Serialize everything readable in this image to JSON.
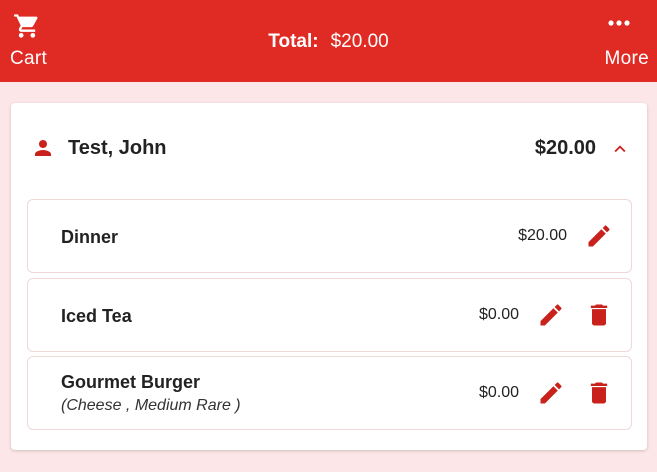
{
  "topbar": {
    "cart_label": "Cart",
    "total_label": "Total:",
    "total_value": "$20.00",
    "more_label": "More",
    "color": "#e02b25"
  },
  "order": {
    "customer_name": "Test, John",
    "customer_total": "$20.00",
    "expanded": true,
    "items": [
      {
        "name": "Dinner",
        "modifiers": "",
        "price": "$20.00",
        "can_delete": false
      },
      {
        "name": "Iced Tea",
        "modifiers": "",
        "price": "$0.00",
        "can_delete": true
      },
      {
        "name": "Gourmet Burger",
        "modifiers": "(Cheese , Medium Rare )",
        "price": "$0.00",
        "can_delete": true
      }
    ]
  },
  "icons": {
    "cart": "cart-icon",
    "more": "more-horizontal-icon",
    "person": "person-icon",
    "collapse": "chevron-up-icon",
    "edit": "pencil-icon",
    "delete": "trash-icon"
  },
  "accent_color": "#c9221c",
  "background_color": "#fde6e7"
}
